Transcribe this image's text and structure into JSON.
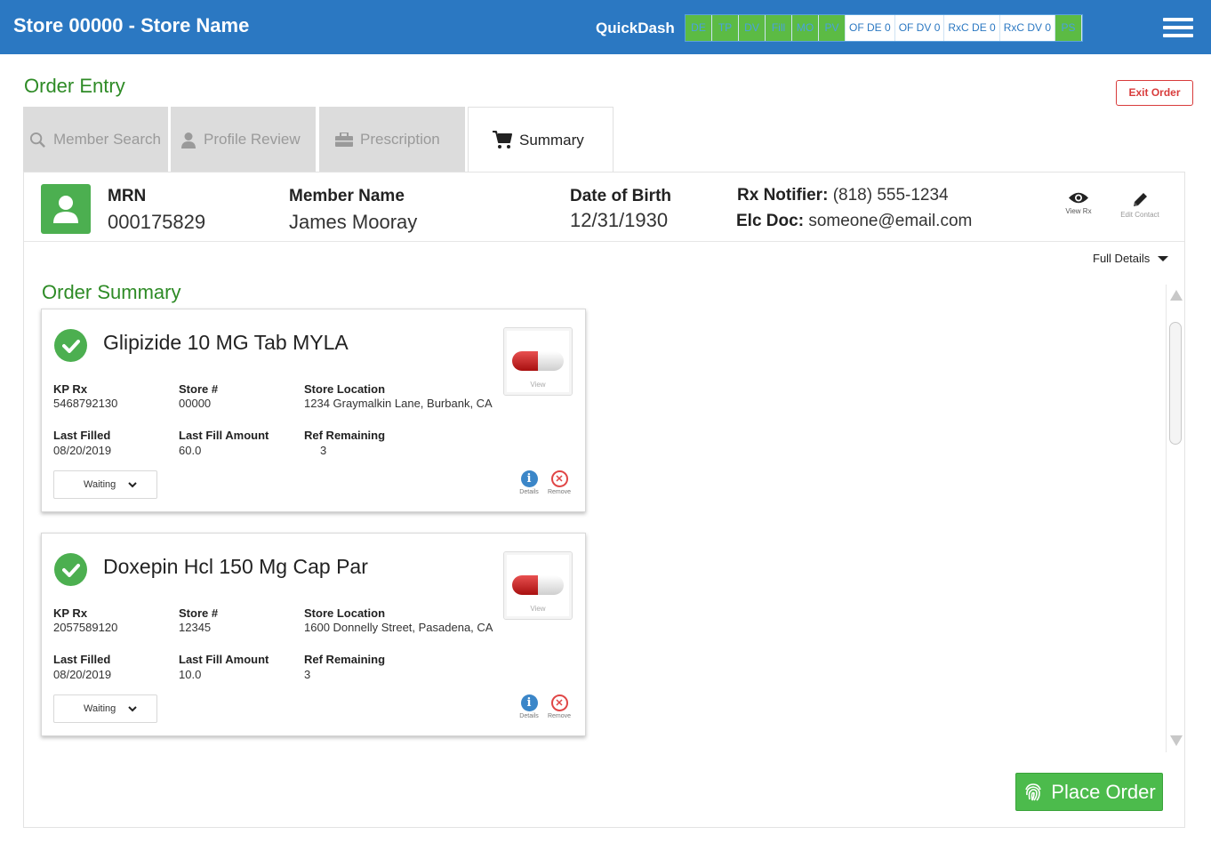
{
  "header": {
    "store_title": "Store 00000 - Store Name",
    "quickdash_label": "QuickDash",
    "quickdash_items": [
      {
        "label": "DE",
        "style": "green"
      },
      {
        "label": "TP",
        "style": "green"
      },
      {
        "label": "DV",
        "style": "green"
      },
      {
        "label": "Fill",
        "style": "green"
      },
      {
        "label": "MO",
        "style": "green"
      },
      {
        "label": "PV",
        "style": "green"
      },
      {
        "label": "OF DE 0",
        "style": "white"
      },
      {
        "label": "OF DV 0",
        "style": "white"
      },
      {
        "label": "RxC DE 0",
        "style": "white"
      },
      {
        "label": "RxC DV 0",
        "style": "white"
      },
      {
        "label": "PS",
        "style": "green"
      }
    ],
    "menu_icon": "hamburger-icon",
    "colors": {
      "bar": "#2b78c2",
      "green": "#5cbb44"
    }
  },
  "page": {
    "title": "Order Entry",
    "exit_label": "Exit Order"
  },
  "tabs": [
    {
      "label": "Member Search",
      "icon": "search-icon",
      "active": false
    },
    {
      "label": "Profile Review",
      "icon": "person-icon",
      "active": false
    },
    {
      "label": "Prescription",
      "icon": "briefcase-icon",
      "active": false
    },
    {
      "label": "Summary",
      "icon": "cart-icon",
      "active": true
    }
  ],
  "member": {
    "mrn_label": "MRN",
    "mrn": "000175829",
    "name_label": "Member Name",
    "name": "James Mooray",
    "dob_label": "Date of Birth",
    "dob": "12/31/1930",
    "notifier_label": "Rx Notifier:",
    "notifier": "(818) 555-1234",
    "elc_label": "Elc Doc:",
    "elc": "someone@email.com",
    "view_rx_label": "View Rx",
    "edit_contact_label": "Edit Contact"
  },
  "full_details_label": "Full Details",
  "order_summary_title": "Order Summary",
  "labels": {
    "kp_rx": "KP Rx",
    "store": "Store #",
    "store_location": "Store Location",
    "last_filled": "Last Filled",
    "last_fill_amount": "Last Fill Amount",
    "ref_remaining": "Ref Remaining",
    "view": "View",
    "details": "Details",
    "remove": "Remove"
  },
  "rx_items": [
    {
      "name": "Glipizide 10 MG Tab MYLA",
      "kp_rx": "5468792130",
      "store": "00000",
      "store_location": "1234 Graymalkin Lane, Burbank, CA",
      "last_filled": "08/20/2019",
      "last_fill_amount": "60.0",
      "ref_remaining": "3",
      "status": "Waiting"
    },
    {
      "name": "Doxepin Hcl 150 Mg Cap Par",
      "kp_rx": "2057589120",
      "store": "12345",
      "store_location": "1600 Donnelly Street, Pasadena, CA",
      "last_filled": "08/20/2019",
      "last_fill_amount": "10.0",
      "ref_remaining": "3",
      "status": "Waiting"
    }
  ],
  "place_order_label": "Place Order"
}
